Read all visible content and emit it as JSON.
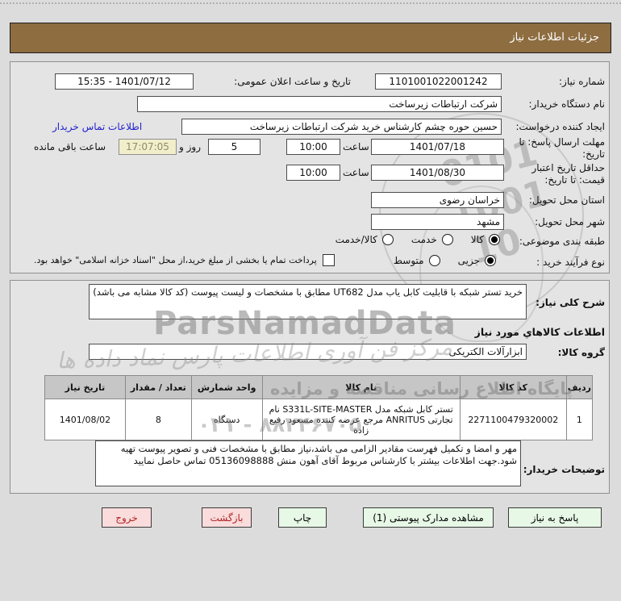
{
  "window": {
    "title": "جزئیات اطلاعات نیاز"
  },
  "form": {
    "need_number": {
      "label": "شماره نیاز:",
      "value": "1101001022001242"
    },
    "announce": {
      "label": "تاریخ و ساعت اعلان عمومی:",
      "value": "1401/07/12 - 15:35"
    },
    "buyer_org": {
      "label": "نام دستگاه خریدار:",
      "value": "شرکت ارتباطات زیرساخت"
    },
    "creator": {
      "label": "ایجاد کننده درخواست:",
      "value": "حسین حوره چشم کارشناس خرید شرکت ارتباطات زیرساخت",
      "contact_link": "اطلاعات تماس خریدار"
    },
    "deadline": {
      "label": "مهلت ارسال پاسخ: تا تاریخ:",
      "date": "1401/07/18",
      "hour_label": "ساعت",
      "hour": "10:00",
      "days": "5",
      "days_label": "روز و",
      "countdown": "17:07:05",
      "remaining_label": "ساعت باقی مانده"
    },
    "validity": {
      "label": "حداقل تاریخ اعتبار قیمت: تا تاریخ:",
      "date": "1401/08/30",
      "hour_label": "ساعت",
      "hour": "10:00"
    },
    "province": {
      "label": "استان محل تحویل:",
      "value": "خراسان رضوی"
    },
    "city": {
      "label": "شهر محل تحویل:",
      "value": "مشهد"
    },
    "classification": {
      "label": "طبقه بندی موضوعی:",
      "options": [
        {
          "label": "کالا",
          "selected": true
        },
        {
          "label": "خدمت",
          "selected": false
        },
        {
          "label": "کالا/خدمت",
          "selected": false
        }
      ]
    },
    "process": {
      "label": "نوع فرآیند خرید :",
      "options": [
        {
          "label": "جزیی",
          "selected": true
        },
        {
          "label": "متوسط",
          "selected": false
        }
      ],
      "treasury_note": "پرداخت تمام یا بخشی از مبلغ خرید،از محل \"اسناد خزانه اسلامی\" خواهد بود.",
      "treasury_checked": false
    }
  },
  "need": {
    "description": {
      "label": "شرح کلی نیاز:",
      "value": "خرید تستر شبکه با قابلیت کابل یاب مدل UT682 مطابق با مشخصات و لیست پیوست (کد کالا مشابه می باشد)"
    },
    "goods_section_title": "اطلاعات کالاهاي مورد نیاز",
    "goods_group": {
      "label": "گروه کالا:",
      "value": "ابزارآلات الکتریکی"
    },
    "table": {
      "headers": [
        "ردیف",
        "کد کالا",
        "نام کالا",
        "واحد شمارش",
        "تعداد / مقدار",
        "تاریخ نیاز"
      ],
      "rows": [
        [
          "1",
          "2271100479320002",
          "تستر کابل شبکه مدل S331L-SITE-MASTER نام تجارتی ANRITUS مرجع عرضه کننده مسعود رفیع زاده",
          "دستگاه",
          "8",
          "1401/08/02"
        ]
      ]
    },
    "buyer_notes": {
      "label": "توضیحات خریدار:",
      "value": "مهر و امضا و تکمیل فهرست مقادیر الزامی می باشد،نیاز مطابق با مشخصات فنی و تصویر پیوست تهیه شود.جهت اطلاعات بیشتر با کارشناس مربوط آقای آهون منش 05136098888 تماس حاصل نمایید"
    }
  },
  "buttons": [
    {
      "label": "پاسخ به نیاز"
    },
    {
      "label": "مشاهده مدارک پیوستی (1)"
    },
    {
      "label": "چاپ"
    },
    {
      "label": "بازگشت"
    },
    {
      "label": "خروج"
    }
  ],
  "watermark": {
    "brand": "ParsNamadData",
    "tagline": "مرکز فن آوری اطلاعات پارس نماد داده ها",
    "site_line": "پایگاه اطلاع رسانی مناقصه و مزایده",
    "phone": "۸۸۲۴۶۷۰۵ - ۰۲۱",
    "stamp_digits_1": "0101",
    "stamp_digits_2": "1001",
    "stamp_digits_3": "10"
  },
  "colors": {
    "header_bg": "#8e6d41",
    "button_green": "#e7f8e7",
    "button_pink": "#fadcdc",
    "countdown_bg": "#f1eecb",
    "link": "#2222cc"
  }
}
